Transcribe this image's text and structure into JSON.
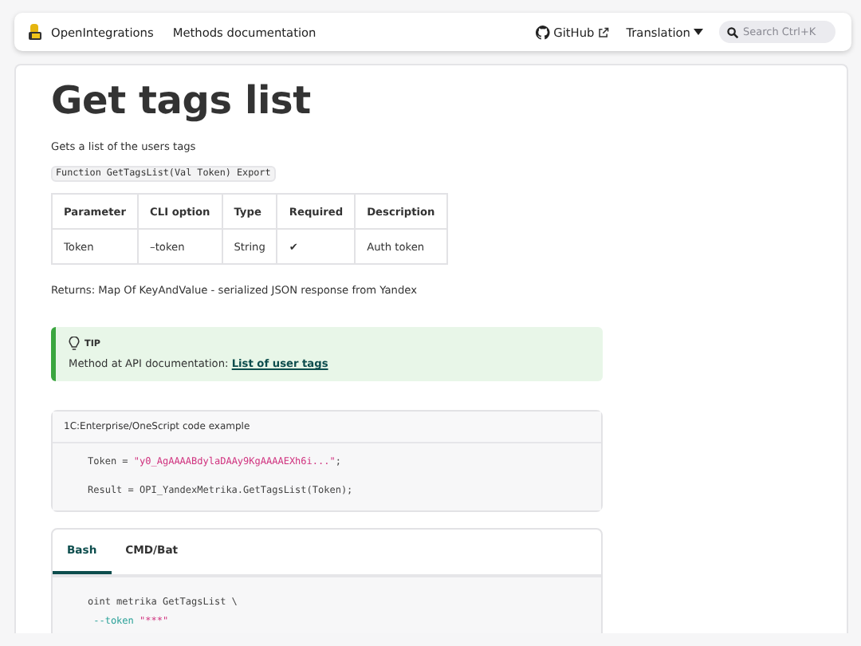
{
  "navbar": {
    "brand": "OpenIntegrations",
    "links": [
      "Methods documentation"
    ],
    "github": "GitHub",
    "translation": "Translation",
    "search": {
      "placeholder": "Search Ctrl+K"
    }
  },
  "title": "Get tags list",
  "description": "Gets a list of the users tags",
  "signature": "Function GetTagsList(Val Token) Export",
  "table": {
    "columns": [
      "Parameter",
      "CLI option",
      "Type",
      "Required",
      "Description"
    ],
    "rows": [
      {
        "cells": [
          "Token",
          "–token",
          "String",
          "✔",
          "Auth token"
        ]
      }
    ]
  },
  "returns": "Returns: Map Of KeyAndValue - serialized JSON response from Yandex",
  "tip": {
    "label": "TIP",
    "text": "Method at API documentation:",
    "link": "List of user tags"
  },
  "code_example": {
    "title": "1C:Enterprise/OneScript code example",
    "lines": [
      {
        "parts": [
          {
            "kind": "plain",
            "text": "Token = "
          },
          {
            "kind": "string",
            "text": "\"y0_AgAAAABdylaDAAy9KgAAAAEXh6i...\""
          },
          {
            "kind": "plain",
            "text": ";"
          }
        ]
      },
      {
        "parts": [
          {
            "kind": "plain",
            "text": "Result = OPI_YandexMetrika.GetTagsList(Token);"
          }
        ]
      }
    ]
  },
  "cli": {
    "tabs": [
      {
        "label": "Bash",
        "selected": true
      },
      {
        "label": "CMD/Bat",
        "selected": false
      }
    ],
    "lines": [
      {
        "parts": [
          {
            "kind": "plain",
            "text": "oint metrika GetTagsList \\"
          }
        ]
      },
      {
        "parts": [
          {
            "kind": "option",
            "text": " --token"
          },
          {
            "kind": "string",
            "text": " \"***\""
          }
        ]
      }
    ]
  }
}
